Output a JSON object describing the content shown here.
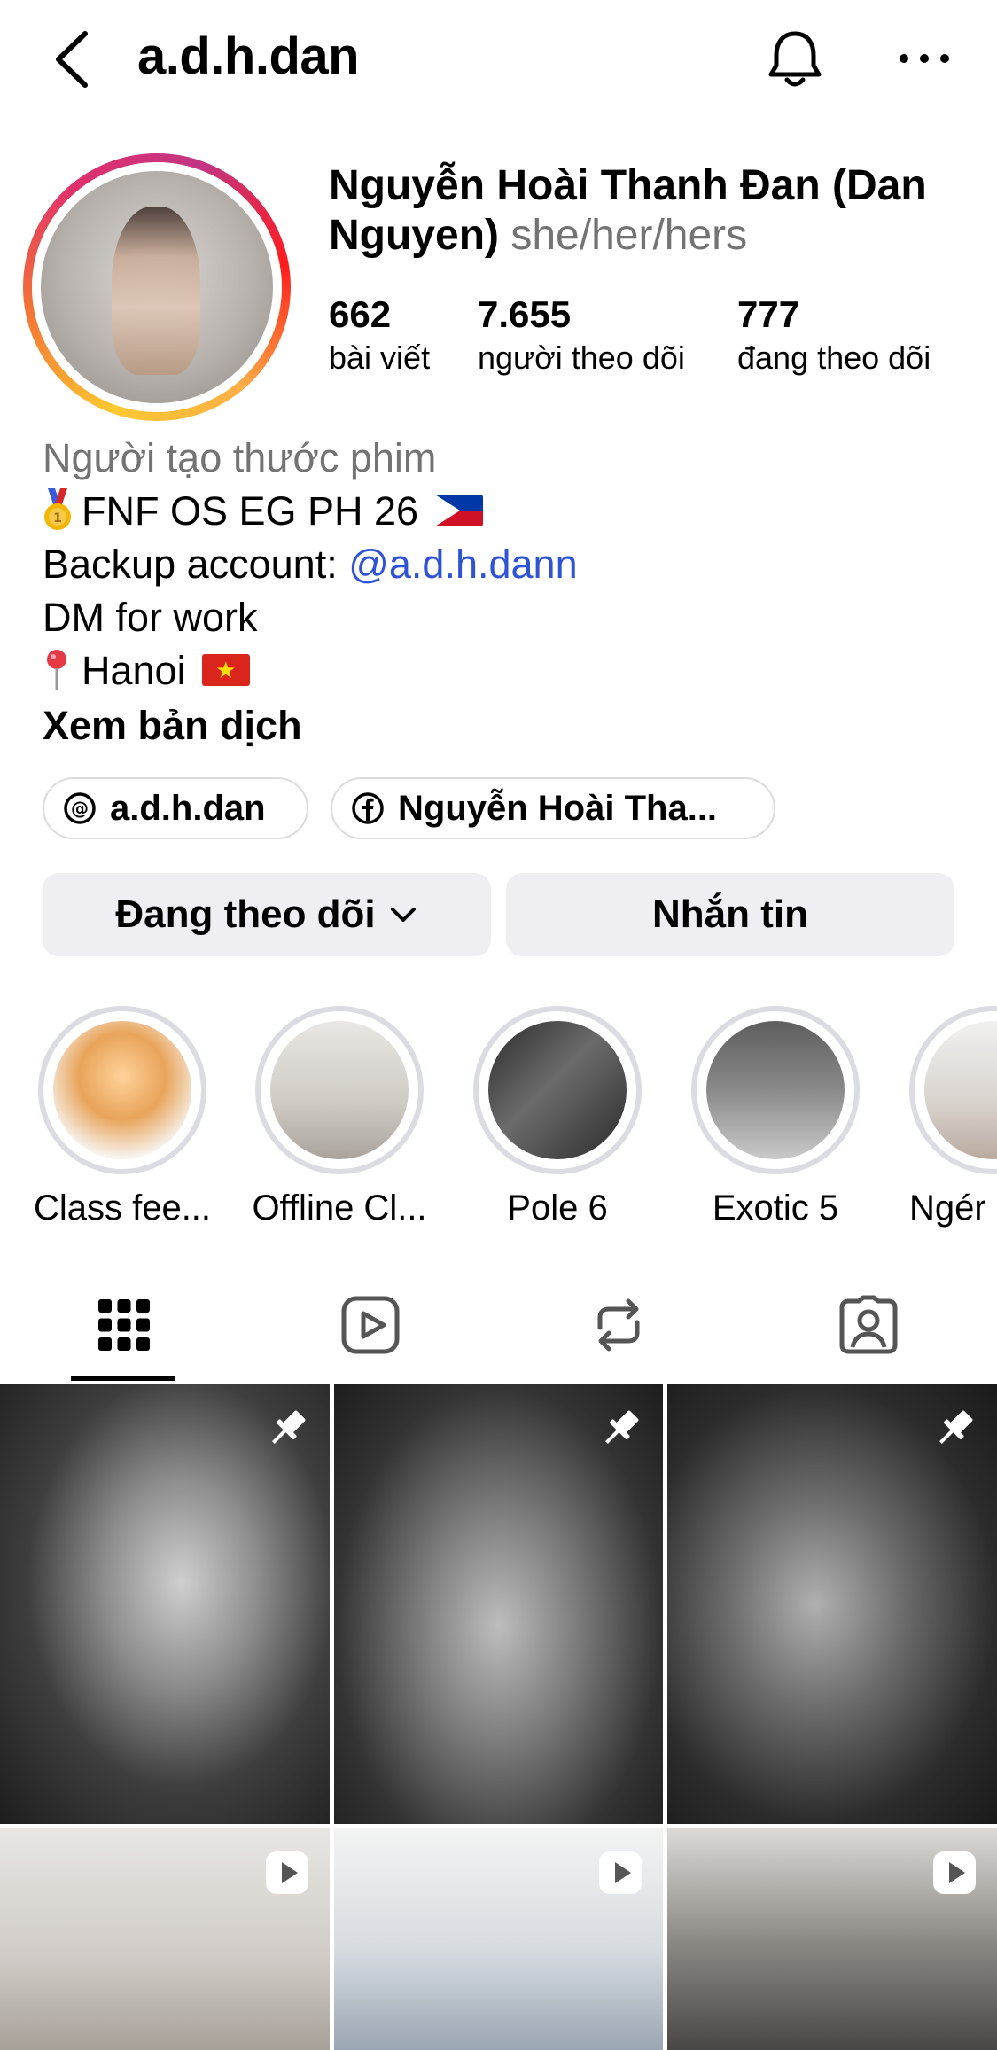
{
  "header": {
    "username": "a.d.h.dan"
  },
  "profile": {
    "full_name": "Nguyễn Hoài Thanh Đan (Dan Nguyen)",
    "pronouns": "she/her/hers",
    "stats": [
      {
        "value": "662",
        "label": "bài viết"
      },
      {
        "value": "7.655",
        "label": "người theo dõi"
      },
      {
        "value": "777",
        "label": "đang theo dõi"
      }
    ]
  },
  "bio": {
    "category": "Người tạo thước phim",
    "line1": "FNF OS EG PH 26",
    "line2_prefix": "Backup account: ",
    "line2_mention": "@a.d.h.dann",
    "line3": "DM for work",
    "line4": "Hanoi",
    "translate": "Xem bản dịch"
  },
  "links": [
    {
      "icon": "threads-icon",
      "label": "a.d.h.dan"
    },
    {
      "icon": "facebook-icon",
      "label": "Nguyễn Hoài Tha..."
    }
  ],
  "actions": {
    "following": "Đang theo dõi",
    "message": "Nhắn tin"
  },
  "highlights": [
    {
      "label": "Class fee..."
    },
    {
      "label": "Offline Cl..."
    },
    {
      "label": "Pole 6"
    },
    {
      "label": "Exotic 5"
    },
    {
      "label": "Ngér n"
    }
  ],
  "tabs": [
    "grid-icon",
    "reels-icon",
    "reposts-icon",
    "tagged-icon"
  ],
  "posts": [
    {
      "type": "pinned"
    },
    {
      "type": "pinned"
    },
    {
      "type": "pinned"
    },
    {
      "type": "reel"
    },
    {
      "type": "reel"
    },
    {
      "type": "reel"
    }
  ],
  "colors": {
    "link": "#2f53d6",
    "secondary_text": "#737373",
    "button_bg": "#efeff3"
  }
}
